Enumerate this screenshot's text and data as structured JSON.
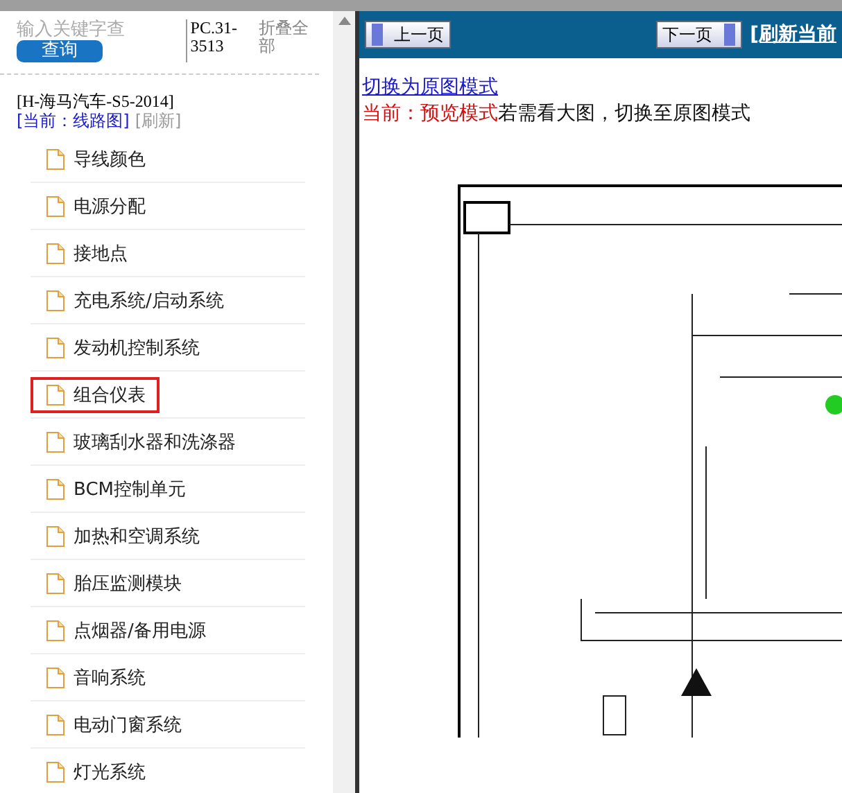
{
  "search": {
    "placeholder": "输入关键字查",
    "button": "查询",
    "code": "PC.31-3513",
    "collapse": "折叠全部"
  },
  "manual": {
    "title": "[H-海马汽车-S5-2014]",
    "current": "[当前：线路图]",
    "refresh": "[刷新]"
  },
  "items": [
    {
      "label": "导线颜色",
      "selected": false
    },
    {
      "label": "电源分配",
      "selected": false
    },
    {
      "label": "接地点",
      "selected": false
    },
    {
      "label": "充电系统/启动系统",
      "selected": false
    },
    {
      "label": "发动机控制系统",
      "selected": false
    },
    {
      "label": "组合仪表",
      "selected": true
    },
    {
      "label": "玻璃刮水器和洗涤器",
      "selected": false
    },
    {
      "label": "BCM控制单元",
      "selected": false
    },
    {
      "label": "加热和空调系统",
      "selected": false
    },
    {
      "label": "胎压监测模块",
      "selected": false
    },
    {
      "label": "点烟器/备用电源",
      "selected": false
    },
    {
      "label": "音响系统",
      "selected": false
    },
    {
      "label": "电动门窗系统",
      "selected": false
    },
    {
      "label": "灯光系统",
      "selected": false
    }
  ],
  "toolbar": {
    "prev": "上一页",
    "next": "下一页",
    "refresh": "[刷新当前"
  },
  "mode": {
    "link": "切换为原图模式",
    "status": "当前：预览模式",
    "hint": "若需看大图，切换至原图模式"
  }
}
